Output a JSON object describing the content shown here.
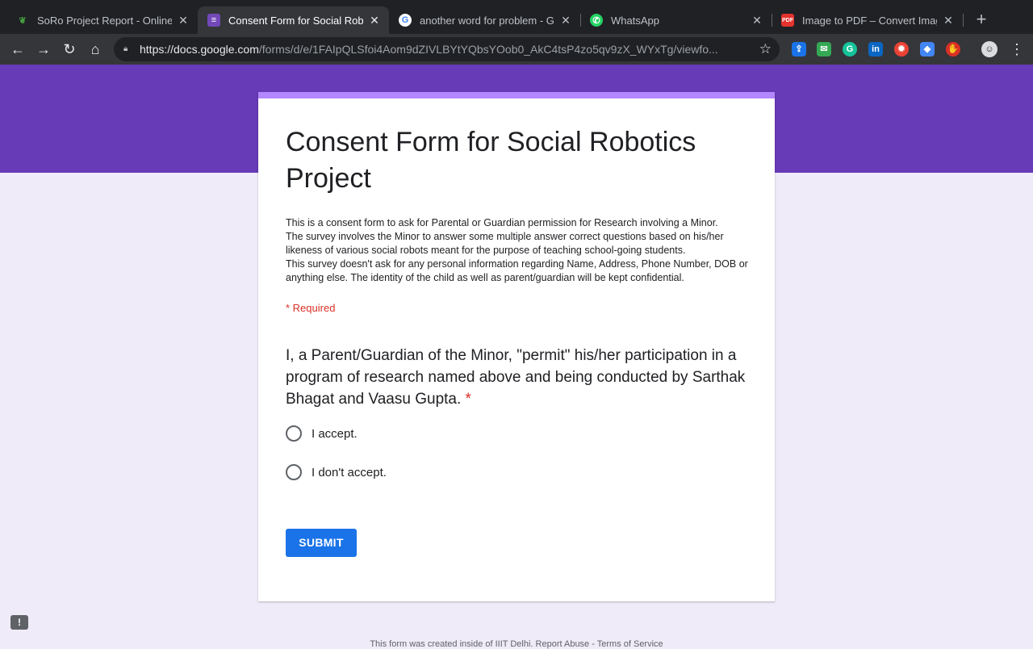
{
  "browser": {
    "tabs": [
      {
        "title": "SoRo Project Report - Online LaTeX Editor"
      },
      {
        "title": "Consent Form for Social Robotics Project"
      },
      {
        "title": "another word for problem - Google Search"
      },
      {
        "title": "WhatsApp"
      },
      {
        "title": "Image to PDF – Convert Images to PDF"
      }
    ],
    "new_tab_label": "+",
    "url_host": "https://docs.google.com",
    "url_path": "/forms/d/e/1FAIpQLSfoi4Aom9dZIVLBYtYQbsYOob0_AkC4tsP4zo5qv9zX_WYxTg/viewfo...",
    "extensions": [
      {
        "icon": "cast-icon",
        "color": "#1a73e8"
      },
      {
        "icon": "mail-check-icon",
        "color": "#34a853"
      },
      {
        "icon": "grammarly-icon",
        "color": "#15c39a"
      },
      {
        "icon": "linkedin-icon",
        "color": "#0a66c2"
      },
      {
        "icon": "fire-icon",
        "color": "#ea4335"
      },
      {
        "icon": "graduation-cap-icon",
        "color": "#4285f4"
      },
      {
        "icon": "adblock-icon",
        "color": "#d93025"
      }
    ]
  },
  "form": {
    "title": "Consent Form for Social Robotics Project",
    "description": [
      "This is a consent form to ask for Parental or Guardian permission for Research involving a Minor.",
      "The survey involves the Minor to answer some multiple answer correct questions based on his/her likeness of various social robots meant for the purpose of teaching school-going students.",
      "This survey doesn't ask for any personal information regarding Name, Address, Phone Number, DOB or anything else. The identity of the child as well as parent/guardian will be kept confidential."
    ],
    "required_note": "* Required",
    "question": "I, a Parent/Guardian of the Minor, \"permit\" his/her participation in a program of research named above and being conducted by Sarthak Bhagat and Vaasu Gupta.",
    "question_required_mark": "*",
    "options": [
      "I accept.",
      "I don't accept."
    ],
    "submit_label": "SUBMIT"
  },
  "footer": {
    "text": "This form was created inside of IIIT Delhi. Report Abuse - Terms of Service"
  },
  "feedback_label": "!"
}
